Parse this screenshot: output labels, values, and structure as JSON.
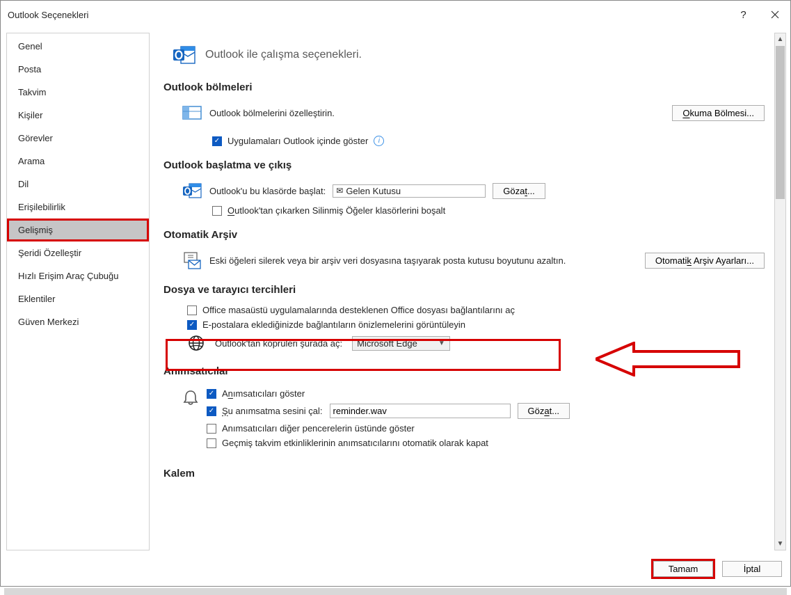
{
  "window": {
    "title": "Outlook Seçenekleri"
  },
  "sidebar": {
    "items": [
      {
        "label": "Genel"
      },
      {
        "label": "Posta"
      },
      {
        "label": "Takvim"
      },
      {
        "label": "Kişiler"
      },
      {
        "label": "Görevler"
      },
      {
        "label": "Arama"
      },
      {
        "label": "Dil"
      },
      {
        "label": "Erişilebilirlik"
      },
      {
        "label": "Gelişmiş"
      },
      {
        "label": "Şeridi Özelleştir"
      },
      {
        "label": "Hızlı Erişim Araç Çubuğu"
      },
      {
        "label": "Eklentiler"
      },
      {
        "label": "Güven Merkezi"
      }
    ]
  },
  "header": {
    "intro": "Outlook ile çalışma seçenekleri."
  },
  "panes": {
    "title": "Outlook bölmeleri",
    "desc": "Outlook bölmelerini özelleştirin.",
    "btn_reading": "Okuma Bölmesi...",
    "chk_apps": "Uygulamaları Outlook içinde göster"
  },
  "startup": {
    "title": "Outlook başlatma ve çıkış",
    "start_in": "Outlook'u bu klasörde başlat:",
    "inbox": "Gelen Kutusu",
    "browse": "Gözat...",
    "empty_on_exit": "Outlook'tan çıkarken Silinmiş Öğeler klasörlerini boşalt"
  },
  "archive": {
    "title": "Otomatik Arşiv",
    "desc": "Eski öğeleri silerek veya bir arşiv veri dosyasına taşıyarak posta kutusu boyutunu azaltın.",
    "btn": "Otomatik Arşiv Ayarları..."
  },
  "filebrowser": {
    "title": "Dosya ve tarayıcı tercihleri",
    "chk_open_office": "Office masaüstü uygulamalarında desteklenen Office dosyası bağlantılarını aç",
    "chk_previews": "E-postalara eklediğinizde bağlantıların önizlemelerini görüntüleyin",
    "open_links_label": "Outlook'tan köprüleri şurada aç:",
    "browser": "Microsoft Edge"
  },
  "reminders": {
    "title": "Anımsatıcılar",
    "chk_show": "Anımsatıcıları göster",
    "chk_play": "Şu anımsatma sesini çal:",
    "sound_file": "reminder.wav",
    "browse": "Gözat...",
    "chk_ontop": "Anımsatıcıları diğer pencerelerin üstünde göster",
    "chk_auto_close": "Geçmiş takvim etkinliklerinin anımsatıcılarını otomatik olarak kapat"
  },
  "pen": {
    "title": "Kalem"
  },
  "footer": {
    "ok": "Tamam",
    "cancel": "İptal"
  }
}
